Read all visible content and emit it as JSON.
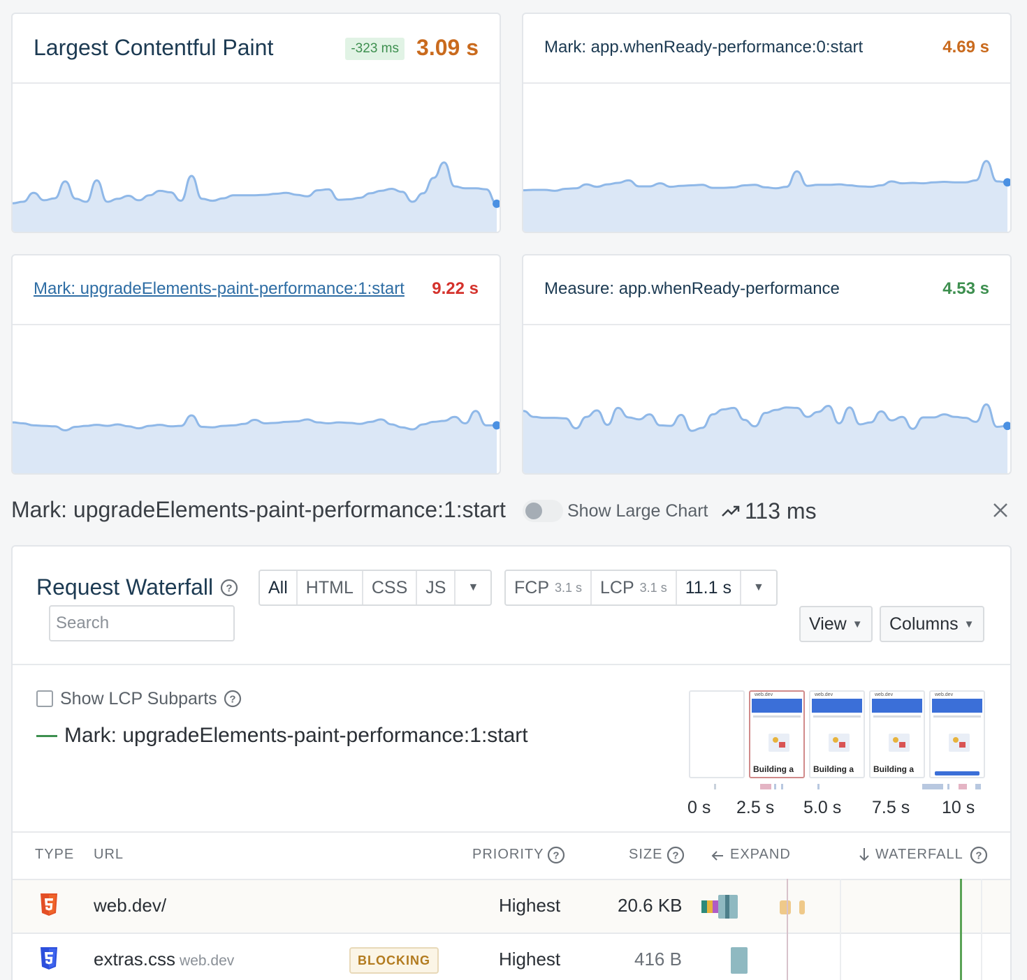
{
  "cards": [
    {
      "title": "Largest Contentful Paint",
      "delta": "-323 ms",
      "value": "3.09 s",
      "value_color": "#c96a1d",
      "chart_data": {
        "type": "area",
        "x": [
          0,
          1,
          2,
          3,
          4,
          5,
          6,
          7,
          8,
          9,
          10,
          11,
          12,
          13,
          14,
          15,
          16,
          17,
          18,
          19,
          20,
          21,
          22,
          23,
          24,
          25,
          26,
          27,
          28,
          29,
          30,
          31,
          32,
          33,
          34,
          35,
          36,
          37,
          38,
          39,
          40,
          41,
          42,
          43,
          44,
          45,
          46
        ],
        "values": [
          6.0,
          6.3,
          8.1,
          6.6,
          7.0,
          10.4,
          6.9,
          6.3,
          10.6,
          6.3,
          6.9,
          7.5,
          6.6,
          7.6,
          8.5,
          8.2,
          6.5,
          11.5,
          6.9,
          6.5,
          7.0,
          7.6,
          7.6,
          7.6,
          7.7,
          7.9,
          8.1,
          7.7,
          7.4,
          8.6,
          8.8,
          6.7,
          6.8,
          7.1,
          8.0,
          8.5,
          8.9,
          8.3,
          6.3,
          8.0,
          11.1,
          14.2,
          9.4,
          9.0,
          9.0,
          8.8,
          5.9
        ],
        "ylim": [
          0,
          30
        ],
        "color": "#8fb8e8",
        "fill": "#dbe7f6"
      }
    },
    {
      "title": "Mark: app.whenReady-performance:0:start",
      "delta": "",
      "value": "4.69 s",
      "value_color": "#c96a1d",
      "chart_data": {
        "type": "area",
        "x": [
          0,
          1,
          2,
          3,
          4,
          5,
          6,
          7,
          8,
          9,
          10,
          11,
          12,
          13,
          14,
          15,
          16,
          17,
          18,
          19,
          20,
          21,
          22,
          23,
          24,
          25,
          26,
          27,
          28,
          29,
          30,
          31,
          32,
          33,
          34,
          35,
          36,
          37,
          38,
          39,
          40,
          41,
          42,
          43,
          44,
          45,
          46
        ],
        "values": [
          8.6,
          8.7,
          8.7,
          8.5,
          8.9,
          9.0,
          9.8,
          9.3,
          9.8,
          10.1,
          10.6,
          9.4,
          9.4,
          10.0,
          9.3,
          9.5,
          9.6,
          9.7,
          9.1,
          9.1,
          9.2,
          9.6,
          9.7,
          9.2,
          9.0,
          9.3,
          12.4,
          9.5,
          9.7,
          9.7,
          9.8,
          9.6,
          9.4,
          9.3,
          9.6,
          10.4,
          10.0,
          10.1,
          10.0,
          10.2,
          10.3,
          10.2,
          10.2,
          10.6,
          14.5,
          10.4,
          10.2
        ],
        "ylim": [
          0,
          30
        ],
        "color": "#8fb8e8",
        "fill": "#dbe7f6"
      }
    },
    {
      "title": "Mark: upgradeElements-paint-performance:1:start",
      "delta": "",
      "value": "9.22 s",
      "value_color": "#d4322c",
      "chart_data": {
        "type": "area",
        "x": [
          0,
          1,
          2,
          3,
          4,
          5,
          6,
          7,
          8,
          9,
          10,
          11,
          12,
          13,
          14,
          15,
          16,
          17,
          18,
          19,
          20,
          21,
          22,
          23,
          24,
          25,
          26,
          27,
          28,
          29,
          30,
          31,
          32,
          33,
          34,
          35,
          36,
          37,
          38,
          39,
          40,
          41,
          42,
          43,
          44,
          45,
          46
        ],
        "values": [
          10.5,
          10.3,
          9.9,
          9.8,
          9.7,
          8.9,
          9.6,
          9.8,
          10.0,
          9.8,
          10.1,
          9.7,
          9.3,
          9.8,
          10.0,
          9.7,
          9.8,
          11.9,
          9.6,
          9.5,
          9.8,
          9.9,
          10.2,
          11.0,
          10.3,
          10.4,
          10.6,
          10.7,
          11.1,
          10.5,
          10.3,
          10.5,
          10.4,
          10.2,
          10.6,
          11.1,
          10.1,
          9.5,
          9.1,
          10.1,
          10.6,
          10.8,
          11.6,
          10.3,
          12.8,
          9.9,
          9.9
        ],
        "ylim": [
          0,
          30
        ],
        "color": "#8fb8e8",
        "fill": "#dbe7f6"
      }
    },
    {
      "title": "Measure: app.whenReady-performance",
      "delta": "",
      "value": "4.53 s",
      "value_color": "#3d8f4f",
      "chart_data": {
        "type": "area",
        "x": [
          0,
          1,
          2,
          3,
          4,
          5,
          6,
          7,
          8,
          9,
          10,
          11,
          12,
          13,
          14,
          15,
          16,
          17,
          18,
          19,
          20,
          21,
          22,
          23,
          24,
          25,
          26,
          27,
          28,
          29,
          30,
          31,
          32,
          33,
          34,
          35,
          36,
          37,
          38,
          39,
          40,
          41,
          42,
          43,
          44,
          45,
          46
        ],
        "values": [
          12.8,
          11.6,
          11.4,
          11.4,
          11.3,
          9.3,
          11.6,
          12.9,
          10.0,
          13.4,
          11.5,
          11.1,
          12.1,
          9.9,
          9.8,
          12.0,
          8.8,
          9.4,
          12.1,
          13.1,
          13.4,
          11.0,
          9.7,
          12.4,
          13.0,
          13.5,
          13.4,
          11.6,
          12.6,
          13.8,
          10.3,
          13.5,
          10.1,
          10.5,
          12.7,
          10.9,
          11.6,
          9.2,
          11.5,
          11.5,
          12.1,
          11.6,
          11.4,
          10.6,
          14.1,
          9.6,
          9.8
        ],
        "ylim": [
          0,
          30
        ],
        "color": "#8fb8e8",
        "fill": "#dbe7f6"
      }
    }
  ],
  "detail": {
    "title": "Mark: upgradeElements-paint-performance:1:start",
    "toggle_label": "Show Large Chart",
    "trend_value": "113 ms"
  },
  "waterfall": {
    "title": "Request Waterfall",
    "search_placeholder": "Search",
    "type_filters": [
      "All",
      "HTML",
      "CSS",
      "JS"
    ],
    "type_filter_active": "All",
    "time_markers": [
      {
        "label": "FCP",
        "value": "3.1 s"
      },
      {
        "label": "LCP",
        "value": "3.1 s"
      }
    ],
    "end_time": "11.1 s",
    "view_label": "View",
    "columns_label": "Columns",
    "lcp_subparts_label": "Show LCP Subparts",
    "lcp_subparts_checked": false,
    "legend": {
      "label": "Mark: upgradeElements-paint-performance:1:start",
      "color": "#3d8f4f"
    },
    "filmstrip": {
      "site": "web.dev",
      "caption": "Building a",
      "timeline_labels": [
        "0 s",
        "2.5 s",
        "5.0 s",
        "7.5 s",
        "10 s"
      ]
    },
    "headers": {
      "type": "TYPE",
      "url": "URL",
      "priority": "PRIORITY",
      "size": "SIZE",
      "expand": "EXPAND",
      "waterfall": "WATERFALL"
    },
    "rows": [
      {
        "type": "html",
        "url": "web.dev/",
        "domain": "",
        "badge": "",
        "priority": "Highest",
        "size": "20.6 KB"
      },
      {
        "type": "css",
        "url": "extras.css",
        "domain": "web.dev",
        "badge": "BLOCKING",
        "priority": "Highest",
        "size": "416 B"
      }
    ]
  }
}
